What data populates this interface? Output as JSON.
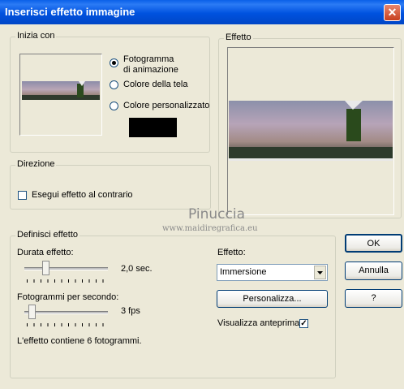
{
  "window": {
    "title": "Inserisci effetto immagine",
    "close_glyph": "✕"
  },
  "start_with": {
    "group_label": "Inizia con",
    "options": [
      {
        "label": "Fotogramma\ndi animazione",
        "selected": true
      },
      {
        "label": "Colore della tela",
        "selected": false
      },
      {
        "label": "Colore personalizzato",
        "selected": false
      }
    ],
    "custom_color": "#000000"
  },
  "effect_preview": {
    "group_label": "Effetto"
  },
  "direction": {
    "group_label": "Direzione",
    "reverse_label": "Esegui effetto al contrario",
    "reverse_checked": false
  },
  "define": {
    "group_label": "Definisci effetto",
    "duration_label": "Durata effetto:",
    "duration_value": "2,0 sec.",
    "fps_label": "Fotogrammi per secondo:",
    "fps_value": "3 fps",
    "frames_info": "L'effetto contiene 6 fotogrammi.",
    "effect_label": "Effetto:",
    "effect_selected": "Immersione",
    "customize_label": "Personalizza...",
    "preview_label": "Visualizza anteprima",
    "preview_checked": true
  },
  "buttons": {
    "ok": "OK",
    "cancel": "Annulla",
    "help": "?"
  },
  "watermark": {
    "name": "Pinuccia",
    "url": "www.maidiregrafica.eu"
  }
}
